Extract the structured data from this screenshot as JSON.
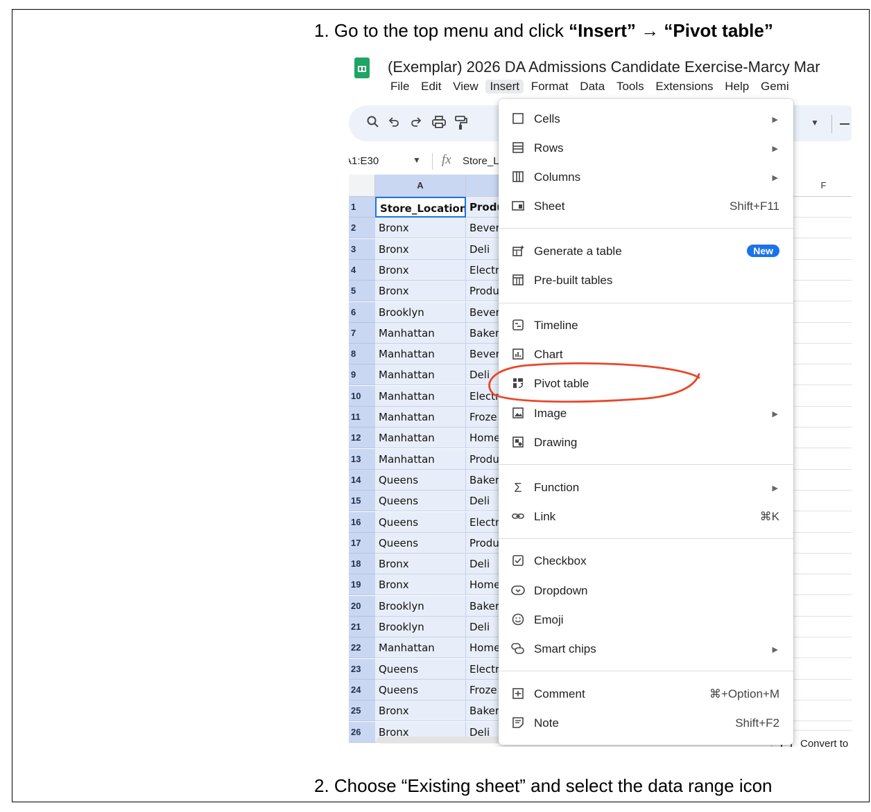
{
  "instructions": {
    "step1_prefix": "1.  Go to the top menu and click ",
    "step1_insert": "“Insert”",
    "step1_arrow": " → ",
    "step1_pivot": "“Pivot table”",
    "step2": "2.  Choose “Existing sheet” and select the data range icon"
  },
  "app": {
    "doc_title": "(Exemplar) 2026 DA Admissions Candidate Exercise-Marcy Mar",
    "menu_items": [
      "File",
      "Edit",
      "View",
      "Insert",
      "Format",
      "Data",
      "Tools",
      "Extensions",
      "Help",
      "Gemi"
    ],
    "active_menu": "Insert",
    "name_box": "A1:E30",
    "formula_icon": "fx",
    "formula_value": "Store_L",
    "column_a_header": "A",
    "column_f_header": "F"
  },
  "rows": [
    {
      "num": "1",
      "a": "Store_Location",
      "b": "Produ"
    },
    {
      "num": "2",
      "a": "Bronx",
      "b": "Bever"
    },
    {
      "num": "3",
      "a": "Bronx",
      "b": "Deli"
    },
    {
      "num": "4",
      "a": "Bronx",
      "b": "Electr"
    },
    {
      "num": "5",
      "a": "Bronx",
      "b": "Produ"
    },
    {
      "num": "6",
      "a": "Brooklyn",
      "b": "Bever"
    },
    {
      "num": "7",
      "a": "Manhattan",
      "b": "Baker"
    },
    {
      "num": "8",
      "a": "Manhattan",
      "b": "Bever"
    },
    {
      "num": "9",
      "a": "Manhattan",
      "b": "Deli"
    },
    {
      "num": "10",
      "a": "Manhattan",
      "b": "Electr"
    },
    {
      "num": "11",
      "a": "Manhattan",
      "b": "Froze"
    },
    {
      "num": "12",
      "a": "Manhattan",
      "b": "Home"
    },
    {
      "num": "13",
      "a": "Manhattan",
      "b": "Produ"
    },
    {
      "num": "14",
      "a": "Queens",
      "b": "Baker"
    },
    {
      "num": "15",
      "a": "Queens",
      "b": "Deli"
    },
    {
      "num": "16",
      "a": "Queens",
      "b": "Electr"
    },
    {
      "num": "17",
      "a": "Queens",
      "b": "Produ"
    },
    {
      "num": "18",
      "a": "Bronx",
      "b": "Deli"
    },
    {
      "num": "19",
      "a": "Bronx",
      "b": "Home"
    },
    {
      "num": "20",
      "a": "Brooklyn",
      "b": "Baker"
    },
    {
      "num": "21",
      "a": "Brooklyn",
      "b": "Deli"
    },
    {
      "num": "22",
      "a": "Manhattan",
      "b": "Home"
    },
    {
      "num": "23",
      "a": "Queens",
      "b": "Electr"
    },
    {
      "num": "24",
      "a": "Queens",
      "b": "Froze"
    },
    {
      "num": "25",
      "a": "Bronx",
      "b": "Baker"
    },
    {
      "num": "26",
      "a": "Bronx",
      "b": "Deli"
    }
  ],
  "insert_menu": {
    "cells": {
      "label": "Cells",
      "icon": "square-icon"
    },
    "rows": {
      "label": "Rows",
      "icon": "rows-icon"
    },
    "columns": {
      "label": "Columns",
      "icon": "columns-icon"
    },
    "sheet": {
      "label": "Sheet",
      "shortcut": "Shift+F11",
      "icon": "sheet-icon"
    },
    "generate_table": {
      "label": "Generate a table",
      "badge": "New",
      "icon": "generate-table-icon"
    },
    "prebuilt_tables": {
      "label": "Pre-built tables",
      "icon": "table-icon"
    },
    "timeline": {
      "label": "Timeline",
      "icon": "timeline-icon"
    },
    "chart": {
      "label": "Chart",
      "icon": "chart-icon"
    },
    "pivot_table": {
      "label": "Pivot table",
      "icon": "pivot-table-icon"
    },
    "image": {
      "label": "Image",
      "icon": "image-icon"
    },
    "drawing": {
      "label": "Drawing",
      "icon": "drawing-icon"
    },
    "function": {
      "label": "Function",
      "icon": "sigma-icon"
    },
    "link": {
      "label": "Link",
      "shortcut": "⌘K",
      "icon": "link-icon"
    },
    "checkbox": {
      "label": "Checkbox",
      "icon": "checkbox-icon"
    },
    "dropdown": {
      "label": "Dropdown",
      "icon": "dropdown-icon"
    },
    "emoji": {
      "label": "Emoji",
      "icon": "emoji-icon"
    },
    "smart_chips": {
      "label": "Smart chips",
      "icon": "smart-chips-icon"
    },
    "comment": {
      "label": "Comment",
      "shortcut": "⌘+Option+M",
      "icon": "comment-icon"
    },
    "note": {
      "label": "Note",
      "shortcut": "Shift+F2",
      "icon": "note-icon"
    }
  },
  "convert_button": {
    "label": "Convert to"
  },
  "annotation_color": "#e8472a"
}
